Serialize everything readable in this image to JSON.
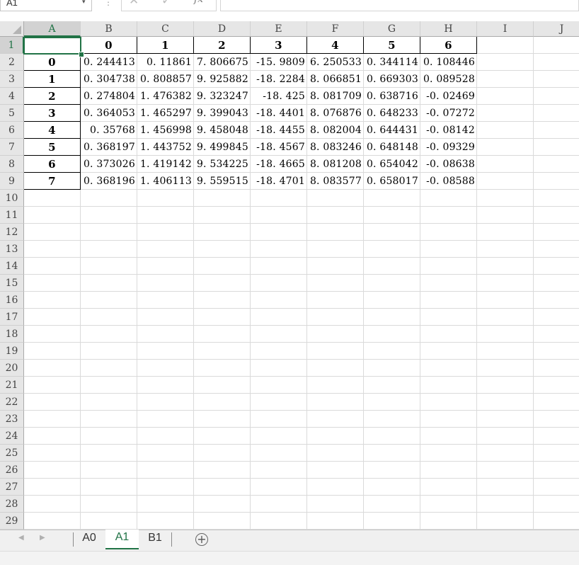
{
  "formula_bar": {
    "name_box": "A1",
    "caret_icon": "▾",
    "dots_icon": "⋮",
    "cancel_icon": "✕",
    "enter_icon": "✓",
    "fx_label": "fx",
    "formula": ""
  },
  "columns": [
    "A",
    "B",
    "C",
    "D",
    "E",
    "F",
    "G",
    "H",
    "I",
    "J"
  ],
  "rows": [
    "1",
    "2",
    "3",
    "4",
    "5",
    "6",
    "7",
    "8",
    "9",
    "10",
    "11",
    "12",
    "13",
    "14",
    "15",
    "16",
    "17",
    "18",
    "19",
    "20",
    "21",
    "22",
    "23",
    "24",
    "25",
    "26",
    "27",
    "28",
    "29"
  ],
  "table": {
    "corner": "",
    "headers": [
      "0",
      "1",
      "2",
      "3",
      "4",
      "5",
      "6"
    ],
    "index": [
      "0",
      "1",
      "2",
      "3",
      "4",
      "5",
      "6",
      "7"
    ],
    "rows": [
      [
        "0. 244413",
        "0. 11861",
        "7. 806675",
        "-15. 9809",
        "6. 250533",
        "0. 344114",
        "0. 108446"
      ],
      [
        "0. 304738",
        "0. 808857",
        "9. 925882",
        "-18. 2284",
        "8. 066851",
        "0. 669303",
        "0. 089528"
      ],
      [
        "0. 274804",
        "1. 476382",
        "9. 323247",
        "-18. 425",
        "8. 081709",
        "0. 638716",
        "-0. 02469"
      ],
      [
        "0. 364053",
        "1. 465297",
        "9. 399043",
        "-18. 4401",
        "8. 076876",
        "0. 648233",
        "-0. 07272"
      ],
      [
        "0. 35768",
        "1. 456998",
        "9. 458048",
        "-18. 4455",
        "8. 082004",
        "0. 644431",
        "-0. 08142"
      ],
      [
        "0. 368197",
        "1. 443752",
        "9. 499845",
        "-18. 4567",
        "8. 083246",
        "0. 648148",
        "-0. 09329"
      ],
      [
        "0. 373026",
        "1. 419142",
        "9. 534225",
        "-18. 4665",
        "8. 081208",
        "0. 654042",
        "-0. 08638"
      ],
      [
        "0. 368196",
        "1. 406113",
        "9. 559515",
        "-18. 4701",
        "8. 083577",
        "0. 658017",
        "-0. 08588"
      ]
    ]
  },
  "sheets": {
    "nav_prev_icon": "◀",
    "nav_next_icon": "▶",
    "tabs": [
      "A0",
      "A1",
      "B1"
    ],
    "active": "A1",
    "add_icon": "+"
  },
  "colors": {
    "accent": "#217346",
    "header_bg": "#e6e6e6",
    "grid": "#dadada"
  }
}
